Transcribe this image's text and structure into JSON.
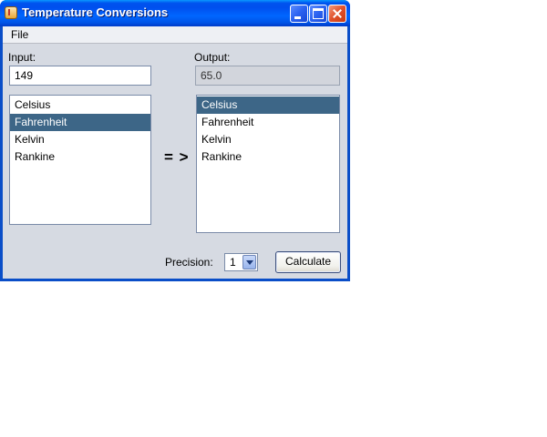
{
  "window": {
    "title": "Temperature Conversions"
  },
  "menubar": {
    "items": [
      {
        "label": "File"
      }
    ]
  },
  "input": {
    "label": "Input:",
    "value": "149"
  },
  "output": {
    "label": "Output:",
    "value": "65.0"
  },
  "from_units": {
    "items": [
      "Celsius",
      "Fahrenheit",
      "Kelvin",
      "Rankine"
    ],
    "selected": "Fahrenheit"
  },
  "to_units": {
    "items": [
      "Celsius",
      "Fahrenheit",
      "Kelvin",
      "Rankine"
    ],
    "selected": "Celsius"
  },
  "arrow": "= >",
  "precision": {
    "label": "Precision:",
    "value": "1"
  },
  "calculate_button": {
    "label": "Calculate"
  },
  "colors": {
    "selection": "#3d6687",
    "panel": "#d6dae2",
    "titlebar": "#0055e8"
  },
  "icons": {
    "app": "java-cup-icon",
    "minimize": "minimize-icon",
    "maximize": "maximize-icon",
    "close": "close-icon",
    "dropdown": "chevron-down-icon"
  }
}
